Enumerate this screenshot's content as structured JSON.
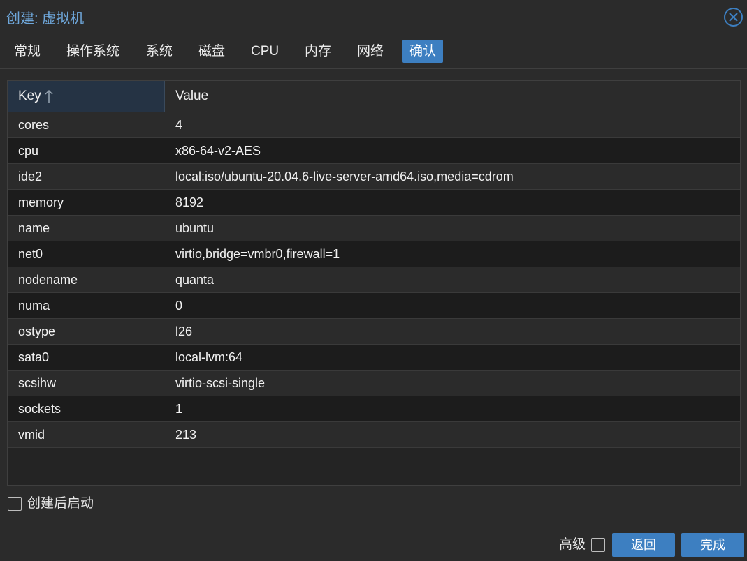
{
  "window": {
    "title": "创建: 虚拟机"
  },
  "tabs": [
    {
      "label": "常规"
    },
    {
      "label": "操作系统"
    },
    {
      "label": "系统"
    },
    {
      "label": "磁盘"
    },
    {
      "label": "CPU"
    },
    {
      "label": "内存"
    },
    {
      "label": "网络"
    },
    {
      "label": "确认",
      "active": true
    }
  ],
  "grid": {
    "columns": {
      "key": "Key",
      "value": "Value"
    },
    "sort": {
      "column": "key",
      "direction": "ascending",
      "icon": "arrow-up-icon"
    },
    "rows": [
      {
        "key": "cores",
        "value": "4"
      },
      {
        "key": "cpu",
        "value": "x86-64-v2-AES"
      },
      {
        "key": "ide2",
        "value": "local:iso/ubuntu-20.04.6-live-server-amd64.iso,media=cdrom"
      },
      {
        "key": "memory",
        "value": "8192"
      },
      {
        "key": "name",
        "value": "ubuntu"
      },
      {
        "key": "net0",
        "value": "virtio,bridge=vmbr0,firewall=1"
      },
      {
        "key": "nodename",
        "value": "quanta"
      },
      {
        "key": "numa",
        "value": "0"
      },
      {
        "key": "ostype",
        "value": "l26"
      },
      {
        "key": "sata0",
        "value": "local-lvm:64"
      },
      {
        "key": "scsihw",
        "value": "virtio-scsi-single"
      },
      {
        "key": "sockets",
        "value": "1"
      },
      {
        "key": "vmid",
        "value": "213"
      }
    ]
  },
  "start_after_create": {
    "label": "创建后启动",
    "checked": false
  },
  "footer": {
    "advanced_label": "高级",
    "advanced_checked": false,
    "back_label": "返回",
    "finish_label": "完成"
  },
  "colors": {
    "accent": "#3d7fc1",
    "title": "#6fa8dc",
    "background": "#2b2b2b",
    "row_alt": "#1c1c1c"
  }
}
